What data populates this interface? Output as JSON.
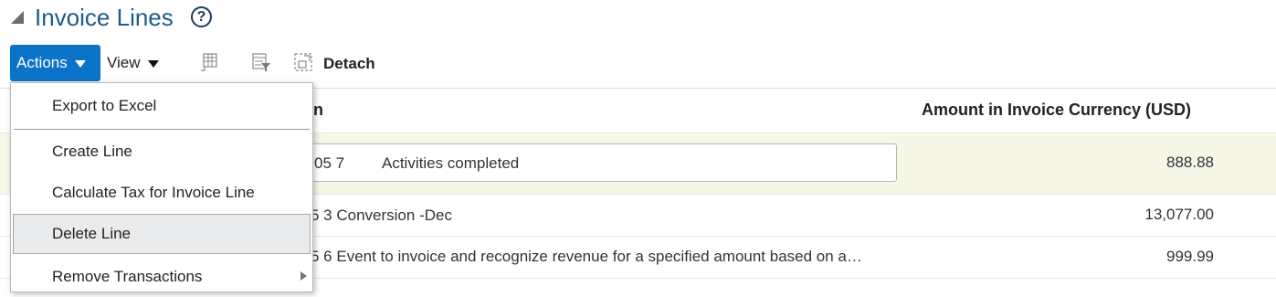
{
  "header": {
    "title": "Invoice Lines",
    "help_icon": "?"
  },
  "toolbar": {
    "actions_label": "Actions",
    "view_label": "View",
    "detach_label": "Detach",
    "icons": [
      "freeze-columns-icon",
      "query-by-example-icon",
      "detach-icon"
    ]
  },
  "table": {
    "columns": {
      "description_fragment": "n",
      "amount": "Amount in Invoice Currency (USD)"
    },
    "rows": [
      {
        "description_prefix": "05 7",
        "description": "Activities completed",
        "amount": "888.88"
      },
      {
        "description": "5 3 Conversion -Dec",
        "amount": "13,077.00"
      },
      {
        "description": "5 6 Event to invoice and recognize revenue for a specified amount based on a…",
        "amount": "999.99"
      }
    ]
  },
  "actions_menu": {
    "items": [
      {
        "label": "Export to Excel"
      },
      {
        "label": "Create Line"
      },
      {
        "label": "Calculate Tax for Invoice Line"
      },
      {
        "label": "Delete Line",
        "highlighted": true
      },
      {
        "label": "Remove Transactions",
        "has_submenu": true
      }
    ]
  },
  "colors": {
    "accent": "#0b74c8",
    "title": "#1e5a8c",
    "selected_row": "#f7f7e7"
  }
}
